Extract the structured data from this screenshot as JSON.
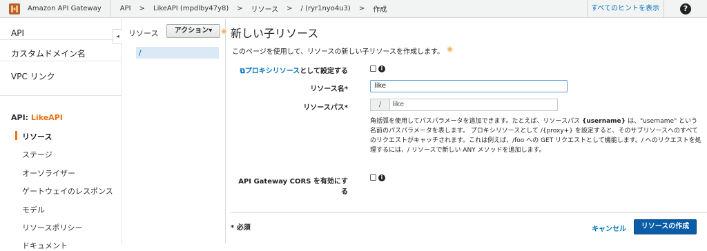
{
  "topbar": {
    "brand": "Amazon API Gateway",
    "breadcrumbs": [
      "API",
      ">",
      "LikeAPI (mpdlby47y8)",
      ">",
      "リソース",
      ">",
      "/ (ryr1nyo4u3)",
      ">",
      "作成"
    ],
    "hints": "すべてのヒントを表示",
    "help": "?"
  },
  "sidebar": {
    "top_items": [
      "API",
      "カスタムドメイン名",
      "VPC リンク"
    ],
    "api_prefix": "API:",
    "api_name": "LikeAPI",
    "items": [
      "リソース",
      "ステージ",
      "オーソライザー",
      "ゲートウェイのレスポンス",
      "モデル",
      "リソースポリシー",
      "ドキュメント"
    ]
  },
  "tree": {
    "title": "リソース",
    "action": "アクション▾",
    "root": "/"
  },
  "form": {
    "title": "新しい子リソース",
    "description": "このページを使用して、リソースの新しい子リソースを作成します。",
    "proxy_link": "プロキシリソース",
    "proxy_suffix": "として設定する",
    "resource_name_label": "リソース名*",
    "resource_name_value": "like",
    "resource_path_label": "リソースパス*",
    "path_prefix": "/",
    "path_value": "like",
    "help_1": "角括弧を使用してパスパラメータを追加できます。たとえば、リソースパス ",
    "help_b1": "{username}",
    "help_2": " は、\"username\" という名前のパスパラメータを表します。 プロキシリソースとして /{proxy+} を設定すると、そのサブリソースへのすべてのリクエストがキャッチされます。これは例えば、/foo への GET リクエストとして機能します。/ へのリクエストを処理するには、/ リソースで新しい ANY メソッドを追加します。",
    "cors_label": "API Gateway CORS を有効にする",
    "required": "* 必須",
    "cancel": "キャンセル",
    "create": "リソースの作成"
  },
  "colors": {
    "accent": "#ec7211",
    "link": "#0073bb",
    "primary": "#0b5ca7"
  },
  "icons": [
    "api-gateway-logo-icon",
    "help-icon",
    "collapse-chevron-icon",
    "info-icon",
    "external-link-icon",
    "hint-dot-icon"
  ]
}
